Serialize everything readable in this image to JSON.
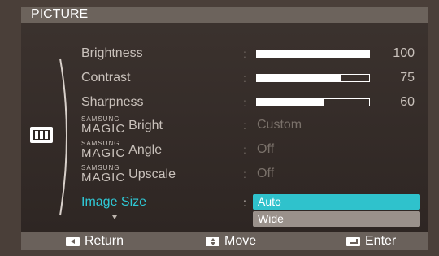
{
  "title": "PICTURE",
  "colors": {
    "accent": "#2fc9d6",
    "background": "#4a3f39"
  },
  "menu": [
    {
      "name": "brightness",
      "label": "Brightness",
      "kind": "bar",
      "value": 100,
      "max": 100
    },
    {
      "name": "contrast",
      "label": "Contrast",
      "kind": "bar",
      "value": 75,
      "max": 100
    },
    {
      "name": "sharpness",
      "label": "Sharpness",
      "kind": "bar",
      "value": 60,
      "max": 100
    },
    {
      "name": "magic-bright",
      "magic_small": "SAMSUNG",
      "magic_big": "MAGIC",
      "label": "Bright",
      "kind": "text",
      "value": "Custom"
    },
    {
      "name": "magic-angle",
      "magic_small": "SAMSUNG",
      "magic_big": "MAGIC",
      "label": "Angle",
      "kind": "text",
      "value": "Off"
    },
    {
      "name": "magic-upscale",
      "magic_small": "SAMSUNG",
      "magic_big": "MAGIC",
      "label": "Upscale",
      "kind": "text",
      "value": "Off"
    },
    {
      "name": "image-size",
      "label": "Image Size",
      "kind": "dropdown"
    }
  ],
  "dropdown": {
    "options": [
      "Auto",
      "Wide"
    ],
    "selected": "Auto"
  },
  "footer": {
    "return_label": "Return",
    "move_label": "Move",
    "enter_label": "Enter"
  },
  "icons": {
    "category": "picture-icon",
    "return": "left-arrow-key-icon",
    "move": "up-down-key-icon",
    "enter": "enter-key-icon"
  }
}
